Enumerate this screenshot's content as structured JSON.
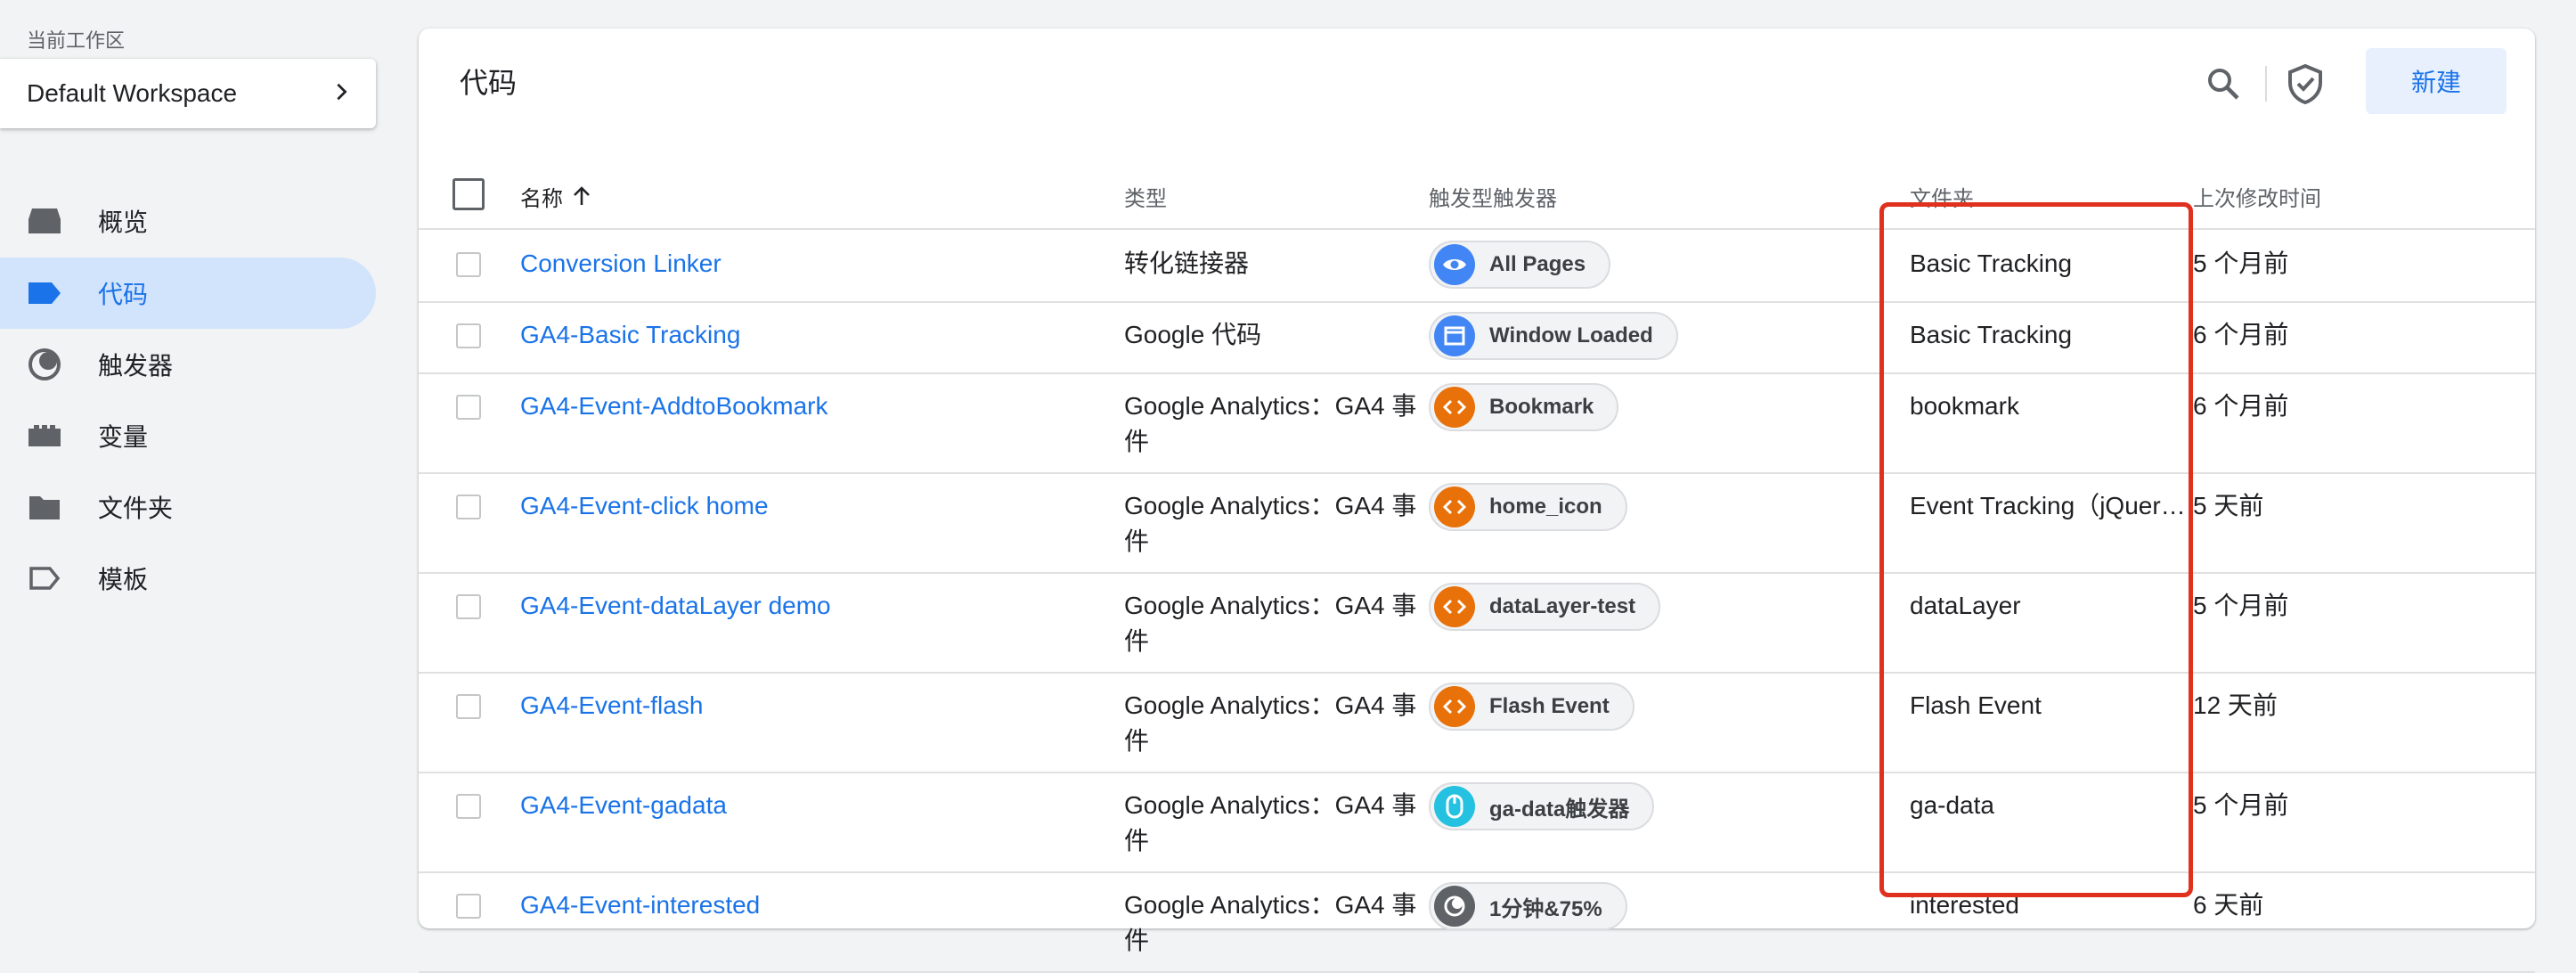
{
  "sidebar": {
    "workspace_label": "当前工作区",
    "workspace_name": "Default Workspace",
    "items": [
      {
        "label": "概览"
      },
      {
        "label": "代码"
      },
      {
        "label": "触发器"
      },
      {
        "label": "变量"
      },
      {
        "label": "文件夹"
      },
      {
        "label": "模板"
      }
    ]
  },
  "main": {
    "title": "代码",
    "new_button": "新建",
    "columns": {
      "name": "名称",
      "type": "类型",
      "trigger": "触发型触发器",
      "folder": "文件夹",
      "modified": "上次修改时间"
    },
    "rows": [
      {
        "name": "Conversion Linker",
        "type": "转化链接器",
        "trigger": "All Pages",
        "trigger_icon": "eye-icon",
        "trigger_color": "#4285f4",
        "folder": "Basic Tracking",
        "modified": "5 个月前"
      },
      {
        "name": "GA4-Basic Tracking",
        "type": "Google 代码",
        "trigger": "Window Loaded",
        "trigger_icon": "window-icon",
        "trigger_color": "#4285f4",
        "folder": "Basic Tracking",
        "modified": "6 个月前"
      },
      {
        "name": "GA4-Event-AddtoBookmark",
        "type": "Google Analytics：GA4 事件",
        "trigger": "Bookmark",
        "trigger_icon": "code-icon",
        "trigger_color": "#e8710a",
        "folder": "bookmark",
        "modified": "6 个月前"
      },
      {
        "name": "GA4-Event-click home",
        "type": "Google Analytics：GA4 事件",
        "trigger": "home_icon",
        "trigger_icon": "code-icon",
        "trigger_color": "#e8710a",
        "folder": "Event Tracking（jQuer…",
        "modified": "5 天前"
      },
      {
        "name": "GA4-Event-dataLayer demo",
        "type": "Google Analytics：GA4 事件",
        "trigger": "dataLayer-test",
        "trigger_icon": "code-icon",
        "trigger_color": "#e8710a",
        "folder": "dataLayer",
        "modified": "5 个月前"
      },
      {
        "name": "GA4-Event-flash",
        "type": "Google Analytics：GA4 事件",
        "trigger": "Flash Event",
        "trigger_icon": "code-icon",
        "trigger_color": "#e8710a",
        "folder": "Flash Event",
        "modified": "12 天前"
      },
      {
        "name": "GA4-Event-gadata",
        "type": "Google Analytics：GA4 事件",
        "trigger": "ga-data触发器",
        "trigger_icon": "mouse-icon",
        "trigger_color": "#24c1e0",
        "folder": "ga-data",
        "modified": "5 个月前"
      },
      {
        "name": "GA4-Event-interested",
        "type": "Google Analytics：GA4 事件",
        "trigger": "1分钟&75%",
        "trigger_icon": "group-icon",
        "trigger_color": "#5f6368",
        "folder": "interested",
        "modified": "6 天前"
      }
    ]
  }
}
